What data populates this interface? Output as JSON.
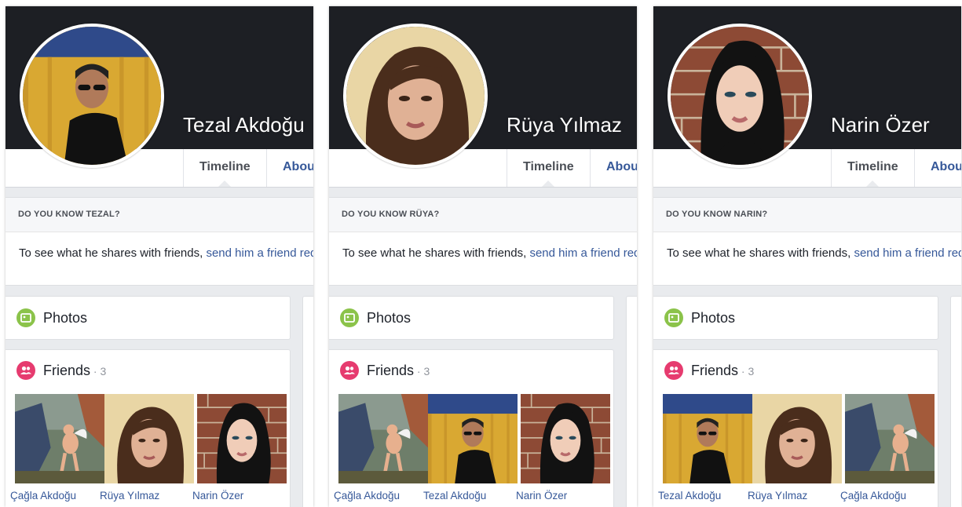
{
  "panels": [
    {
      "name": "Tezal Akdoğu",
      "tabs": [
        "Timeline",
        "About"
      ],
      "know_title": "DO YOU KNOW TEZAL?",
      "know_text": "To see what he shares with friends,",
      "know_link": "send him a friend request",
      "photos_label": "Photos",
      "friends_label": "Friends",
      "friends_count": " · 3",
      "friends": [
        "Çağla Akdoğu",
        "Rüya Yılmaz",
        "Narin Özer"
      ]
    },
    {
      "name": "Rüya Yılmaz",
      "tabs": [
        "Timeline",
        "About"
      ],
      "know_title": "DO YOU KNOW RÜYA?",
      "know_text": "To see what he shares with friends,",
      "know_link": "send him a friend request",
      "photos_label": "Photos",
      "friends_label": "Friends",
      "friends_count": " · 3",
      "friends": [
        "Çağla Akdoğu",
        "Tezal Akdoğu",
        "Narin Özer"
      ]
    },
    {
      "name": "Narin Özer",
      "tabs": [
        "Timeline",
        "About"
      ],
      "know_title": "DO YOU KNOW NARIN?",
      "know_text": "To see what he shares with friends,",
      "know_link": "send him a friend request",
      "photos_label": "Photos",
      "friends_label": "Friends",
      "friends_count": " · 3",
      "friends": [
        "Tezal Akdoğu",
        "Rüya Yılmaz",
        "Çağla Akdoğu"
      ]
    }
  ],
  "colors": {
    "cover": "#1d1f24",
    "link": "#365899",
    "photos_icon": "#8bc34a",
    "friends_icon": "#e63b6f"
  }
}
